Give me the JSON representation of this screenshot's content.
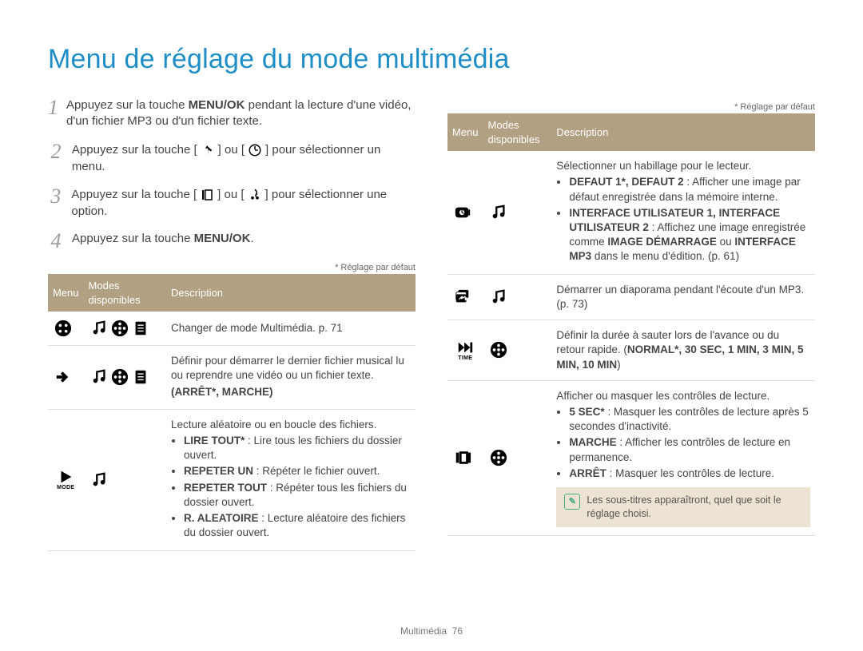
{
  "title": "Menu de réglage du mode multimédia",
  "steps": [
    {
      "num": "1",
      "text_a": "Appuyez sur la touche ",
      "bold_a": "MENU/OK",
      "text_b": " pendant la lecture d'une vidéo, d'un fichier MP3 ou d'un fichier texte."
    },
    {
      "num": "2",
      "text_a": "Appuyez sur la touche [",
      "icon_a": "up-icon",
      "mid": "] ou [",
      "icon_b": "down-icon",
      "text_b": "] pour sélectionner un menu."
    },
    {
      "num": "3",
      "text_a": "Appuyez sur la touche [",
      "icon_a": "left-icon",
      "mid": "] ou [",
      "icon_b": "right-icon",
      "text_b": "] pour sélectionner une option."
    },
    {
      "num": "4",
      "text_a": "Appuyez sur la touche ",
      "bold_a": "MENU/OK",
      "text_b": "."
    }
  ],
  "footnote": "* Réglage par défaut",
  "table_headers": {
    "menu": "Menu",
    "modes": "Modes disponibles",
    "desc": "Description"
  },
  "left_rows": [
    {
      "menu_icon": "menu-grid-icon",
      "modes": [
        "music-icon",
        "film-icon",
        "doc-icon"
      ],
      "desc_html": "Changer de mode Multimédia. p. 71"
    },
    {
      "menu_icon": "resume-arrow-icon",
      "modes": [
        "music-icon",
        "film-icon",
        "doc-icon"
      ],
      "desc_plain": "Définir pour démarrer le dernier fichier musical lu ou reprendre une vidéo ou un fichier texte.",
      "desc_bold_paren": "(ARRÊT*, MARCHE)"
    },
    {
      "menu_icon": "play-mode-icon",
      "menu_label": "MODE",
      "modes": [
        "music-icon"
      ],
      "desc_plain": "Lecture aléatoire ou en boucle des fichiers.",
      "bullets": [
        {
          "bold": "LIRE TOUT*",
          "rest": " : Lire tous les fichiers du dossier ouvert."
        },
        {
          "bold": "REPETER UN",
          "rest": " : Répéter le fichier ouvert."
        },
        {
          "bold": "REPETER TOUT",
          "rest": " : Répéter tous les fichiers du dossier ouvert."
        },
        {
          "bold": "R. ALEATOIRE",
          "rest": " : Lecture aléatoire des fichiers du dossier ouvert."
        }
      ]
    }
  ],
  "right_rows": [
    {
      "menu_icon": "skin-icon",
      "modes": [
        "music-icon"
      ],
      "desc_plain": "Sélectionner un habillage pour le lecteur.",
      "bullets": [
        {
          "bold": "DEFAUT 1*, DEFAUT 2",
          "rest": " : Afficher une image par défaut enregistrée dans la mémoire interne."
        },
        {
          "bold": "INTERFACE UTILISATEUR 1, INTERFACE UTILISATEUR 2",
          "rest": " : Affichez une image enregistrée comme ",
          "bold2": "IMAGE DÉMARRAGE",
          "rest2": " ou ",
          "bold3": "INTERFACE MP3",
          "rest3": " dans le menu d'édition. (p. 61)"
        }
      ]
    },
    {
      "menu_icon": "slideshow-icon",
      "modes": [
        "music-icon"
      ],
      "desc_plain": "Démarrer un diaporama pendant l'écoute d'un MP3. (p. 73)"
    },
    {
      "menu_icon": "skip-time-icon",
      "menu_label": "TIME",
      "modes": [
        "film-icon"
      ],
      "desc_plain_a": "Définir la durée à sauter lors de l'avance ou du retour rapide. (",
      "bold_inline": "NORMAL*, 30 SEC, 1 MIN, 3 MIN, 5 MIN, 10 MIN",
      "desc_plain_b": ")"
    },
    {
      "menu_icon": "controls-icon",
      "modes": [
        "film-icon"
      ],
      "desc_plain": "Afficher ou masquer les contrôles de lecture.",
      "bullets": [
        {
          "bold": "5 SEC*",
          "rest": " : Masquer les contrôles de lecture après 5 secondes d'inactivité."
        },
        {
          "bold": "MARCHE",
          "rest": " : Afficher les contrôles de lecture en permanence."
        },
        {
          "bold": "ARRÊT",
          "rest": " : Masquer les contrôles de lecture."
        }
      ],
      "note": "Les sous-titres apparaîtront, quel que soit le réglage choisi."
    }
  ],
  "footer": {
    "section": "Multimédia",
    "page": "76"
  }
}
